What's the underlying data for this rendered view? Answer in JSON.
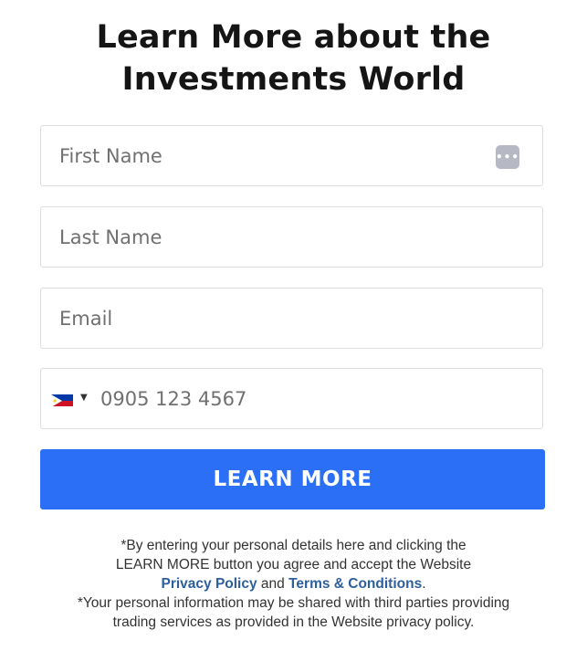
{
  "header": {
    "title_line1": "Learn More about the",
    "title_line2": "Investments World"
  },
  "form": {
    "first_name": {
      "placeholder": "First Name",
      "value": "",
      "badge_icon": "password-manager-icon",
      "badge_text": "•••"
    },
    "last_name": {
      "placeholder": "Last Name",
      "value": ""
    },
    "email": {
      "placeholder": "Email",
      "value": ""
    },
    "phone": {
      "placeholder": "0905 123 4567",
      "value": "",
      "country_icon": "philippines-flag-icon",
      "caret": "▼"
    },
    "submit_label": "LEARN MORE"
  },
  "legal": {
    "line1": "*By entering your personal details here and clicking the",
    "line2": "LEARN MORE button you agree and accept the Website",
    "privacy_link": "Privacy Policy",
    "and": " and ",
    "terms_link": "Terms & Conditions",
    "period": ".",
    "line4": "*Your personal information may be shared with third parties providing",
    "line5": "trading services as provided in the Website privacy policy."
  },
  "colors": {
    "button": "#2a6ff6",
    "link": "#2c5f9e",
    "border": "#dcdde1"
  }
}
